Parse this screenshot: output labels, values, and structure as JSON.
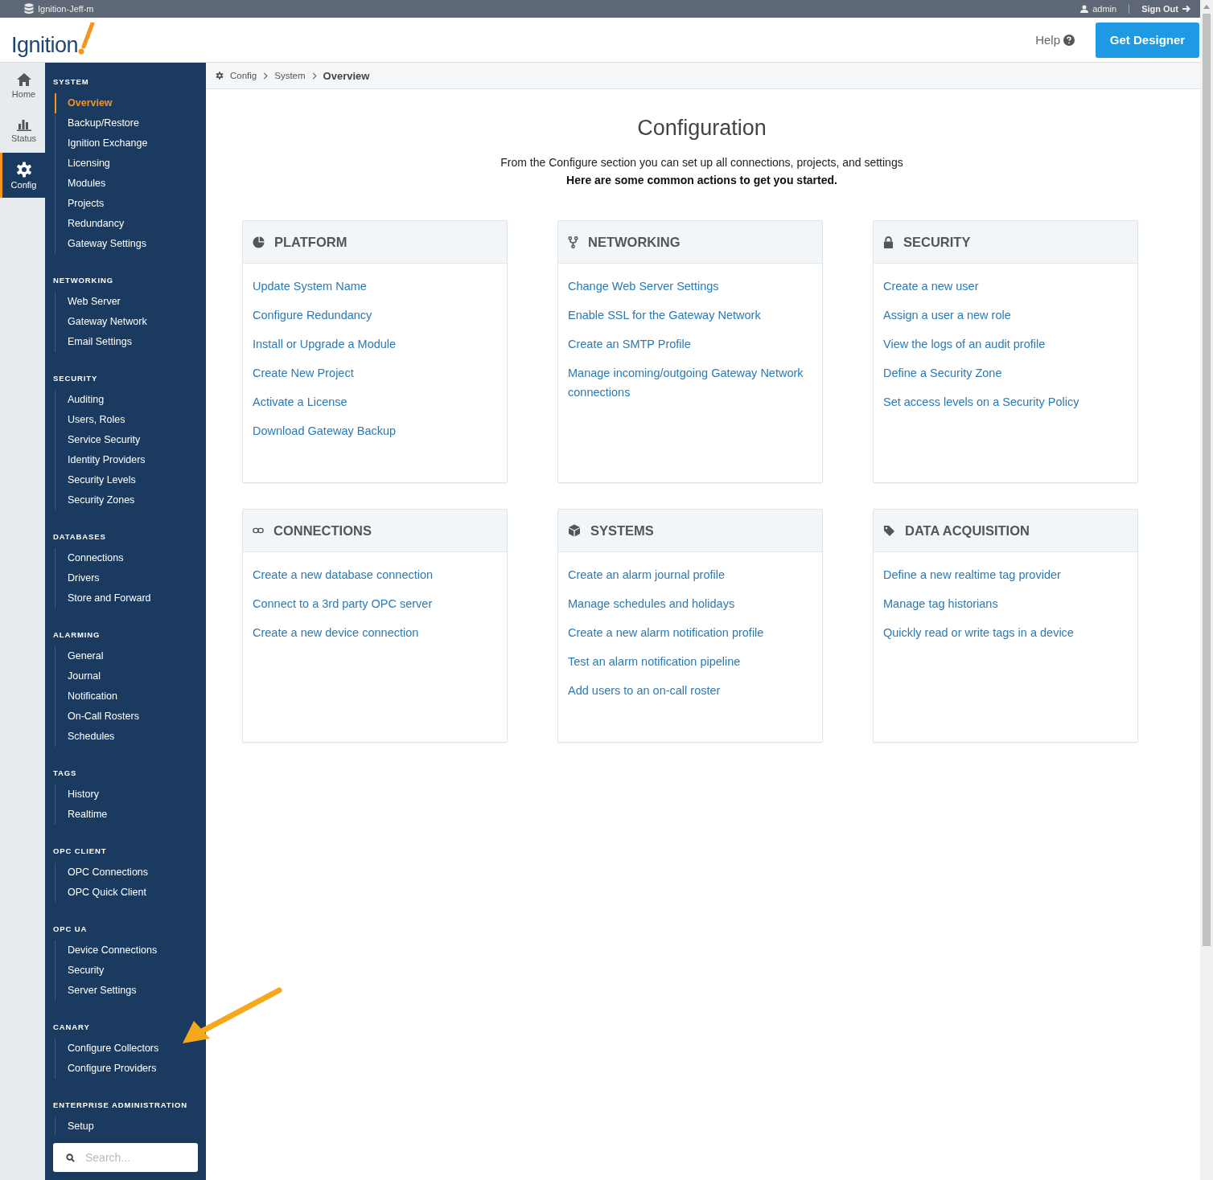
{
  "topbar": {
    "gateway_name": "Ignition-Jeff-m",
    "user": "admin",
    "sign_out": "Sign Out"
  },
  "header": {
    "logo": "Ignition",
    "help": "Help",
    "get_designer": "Get Designer"
  },
  "rail": [
    {
      "label": "Home",
      "selected": false
    },
    {
      "label": "Status",
      "selected": false
    },
    {
      "label": "Config",
      "selected": true
    }
  ],
  "sidebar": {
    "sections": [
      {
        "title": "SYSTEM",
        "items": [
          {
            "label": "Overview",
            "selected": true
          },
          {
            "label": "Backup/Restore",
            "selected": false
          },
          {
            "label": "Ignition Exchange",
            "selected": false
          },
          {
            "label": "Licensing",
            "selected": false
          },
          {
            "label": "Modules",
            "selected": false
          },
          {
            "label": "Projects",
            "selected": false
          },
          {
            "label": "Redundancy",
            "selected": false
          },
          {
            "label": "Gateway Settings",
            "selected": false
          }
        ]
      },
      {
        "title": "NETWORKING",
        "items": [
          {
            "label": "Web Server",
            "selected": false
          },
          {
            "label": "Gateway Network",
            "selected": false
          },
          {
            "label": "Email Settings",
            "selected": false
          }
        ]
      },
      {
        "title": "SECURITY",
        "items": [
          {
            "label": "Auditing",
            "selected": false
          },
          {
            "label": "Users, Roles",
            "selected": false
          },
          {
            "label": "Service Security",
            "selected": false
          },
          {
            "label": "Identity Providers",
            "selected": false
          },
          {
            "label": "Security Levels",
            "selected": false
          },
          {
            "label": "Security Zones",
            "selected": false
          }
        ]
      },
      {
        "title": "DATABASES",
        "items": [
          {
            "label": "Connections",
            "selected": false
          },
          {
            "label": "Drivers",
            "selected": false
          },
          {
            "label": "Store and Forward",
            "selected": false
          }
        ]
      },
      {
        "title": "ALARMING",
        "items": [
          {
            "label": "General",
            "selected": false
          },
          {
            "label": "Journal",
            "selected": false
          },
          {
            "label": "Notification",
            "selected": false
          },
          {
            "label": "On-Call Rosters",
            "selected": false
          },
          {
            "label": "Schedules",
            "selected": false
          }
        ]
      },
      {
        "title": "TAGS",
        "items": [
          {
            "label": "History",
            "selected": false
          },
          {
            "label": "Realtime",
            "selected": false
          }
        ]
      },
      {
        "title": "OPC CLIENT",
        "items": [
          {
            "label": "OPC Connections",
            "selected": false
          },
          {
            "label": "OPC Quick Client",
            "selected": false
          }
        ]
      },
      {
        "title": "OPC UA",
        "items": [
          {
            "label": "Device Connections",
            "selected": false
          },
          {
            "label": "Security",
            "selected": false
          },
          {
            "label": "Server Settings",
            "selected": false
          }
        ]
      },
      {
        "title": "CANARY",
        "items": [
          {
            "label": "Configure Collectors",
            "selected": false
          },
          {
            "label": "Configure Providers",
            "selected": false
          }
        ]
      },
      {
        "title": "ENTERPRISE ADMINISTRATION",
        "items": [
          {
            "label": "Setup",
            "selected": false
          }
        ]
      }
    ],
    "search": {
      "placeholder": "Search..."
    }
  },
  "breadcrumb": [
    "Config",
    "System",
    "Overview"
  ],
  "page": {
    "title": "Configuration",
    "intro": "From the Configure section you can set up all connections, projects, and settings",
    "intro_bold": "Here are some common actions to get you started."
  },
  "cards": [
    {
      "title": "PLATFORM",
      "links": [
        "Update System Name",
        "Configure Redundancy",
        "Install or Upgrade a Module",
        "Create New Project",
        "Activate a License",
        "Download Gateway Backup"
      ]
    },
    {
      "title": "NETWORKING",
      "links": [
        "Change Web Server Settings",
        "Enable SSL for the Gateway Network",
        "Create an SMTP Profile",
        "Manage incoming/outgoing Gateway Network connections"
      ]
    },
    {
      "title": "SECURITY",
      "links": [
        "Create a new user",
        "Assign a user a new role",
        "View the logs of an audit profile",
        "Define a Security Zone",
        "Set access levels on a Security Policy"
      ]
    },
    {
      "title": "CONNECTIONS",
      "links": [
        "Create a new database connection",
        "Connect to a 3rd party OPC server",
        "Create a new device connection"
      ]
    },
    {
      "title": "SYSTEMS",
      "links": [
        "Create an alarm journal profile",
        "Manage schedules and holidays",
        "Create a new alarm notification profile",
        "Test an alarm notification pipeline",
        "Add users to an on-call roster"
      ]
    },
    {
      "title": "DATA ACQUISITION",
      "links": [
        "Define a new realtime tag provider",
        "Manage tag historians",
        "Quickly read or write tags in a device"
      ]
    }
  ]
}
